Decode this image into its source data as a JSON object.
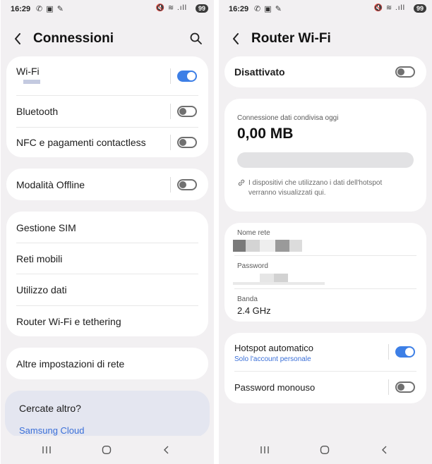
{
  "status": {
    "time": "16:29",
    "battery": "99",
    "notif_icons": "✆ ▣ ✎",
    "system_icons": "🔇 ≋ .ıll"
  },
  "left": {
    "title": "Connessioni",
    "group1": [
      {
        "label": "Wi-Fi",
        "toggle": "on"
      },
      {
        "label": "Bluetooth",
        "toggle": "off"
      },
      {
        "label": "NFC e pagamenti contactless",
        "toggle": "off"
      }
    ],
    "offline": {
      "label": "Modalità Offline",
      "toggle": "off"
    },
    "group3": [
      "Gestione SIM",
      "Reti mobili",
      "Utilizzo dati",
      "Router Wi-Fi e tethering"
    ],
    "more": "Altre impostazioni di rete",
    "suggest": {
      "title": "Cercate altro?",
      "link": "Samsung Cloud"
    }
  },
  "right": {
    "title": "Router Wi-Fi",
    "master": {
      "label": "Disattivato",
      "toggle": "off"
    },
    "data": {
      "caption": "Connessione dati condivisa oggi",
      "value": "0,00 MB",
      "info": "I dispositivi che utilizzano i dati dell'hotspot verranno visualizzati qui."
    },
    "network": {
      "name_label": "Nome rete",
      "password_label": "Password",
      "band_label": "Banda",
      "band_value": "2.4 GHz"
    },
    "auto": {
      "label": "Hotspot automatico",
      "sub": "Solo l'account personale",
      "toggle": "on"
    },
    "otp": {
      "label": "Password monouso",
      "toggle": "off"
    }
  },
  "colors": {
    "accent": "#3d7fe6",
    "link": "#3a6fd8",
    "background": "#f2f0f2",
    "card": "#ffffff"
  }
}
